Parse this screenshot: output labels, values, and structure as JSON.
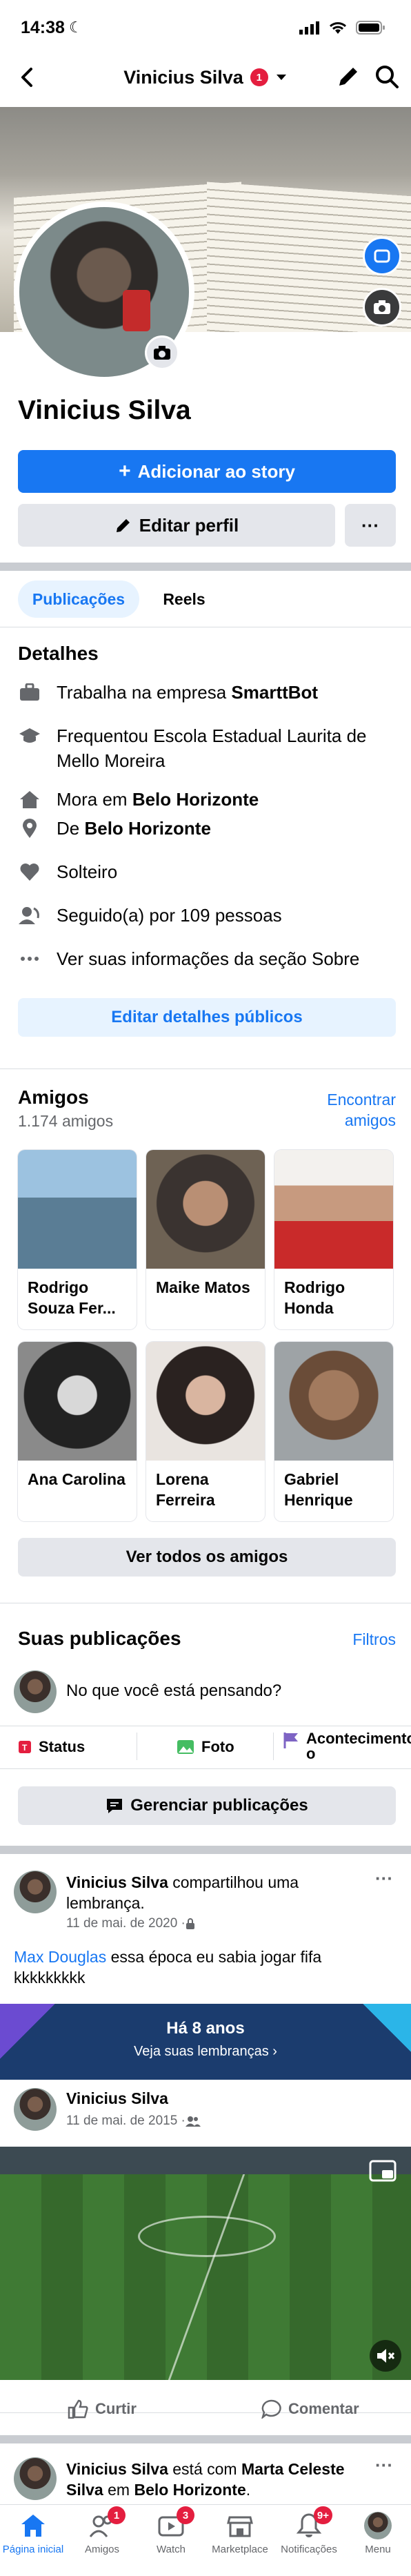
{
  "status_bar": {
    "time": "14:38"
  },
  "header": {
    "title": "Vinicius Silva",
    "badge": "1"
  },
  "profile": {
    "name": "Vinicius Silva",
    "add_story": "Adicionar ao story",
    "edit_profile": "Editar perfil",
    "more": "···"
  },
  "tabs": [
    {
      "label": "Publicações"
    },
    {
      "label": "Reels"
    }
  ],
  "details": {
    "heading": "Detalhes",
    "items": [
      {
        "prefix": "Trabalha na empresa ",
        "bold": "SmarttBot",
        "suffix": ""
      },
      {
        "prefix": "Frequentou Escola Estadual Laurita de Mello Moreira",
        "bold": "",
        "suffix": ""
      },
      {
        "prefix": "Mora em ",
        "bold": "Belo Horizonte",
        "suffix": ""
      },
      {
        "prefix": "De ",
        "bold": "Belo Horizonte",
        "suffix": ""
      },
      {
        "prefix": "Solteiro",
        "bold": "",
        "suffix": ""
      },
      {
        "prefix": "Seguido(a) por 109 pessoas",
        "bold": "",
        "suffix": ""
      },
      {
        "prefix": "Ver suas informações da seção Sobre",
        "bold": "",
        "suffix": ""
      }
    ],
    "edit_button": "Editar detalhes públicos"
  },
  "friends": {
    "heading": "Amigos",
    "count": "1.174 amigos",
    "find_line1": "Encontrar",
    "find_line2": "amigos",
    "list": [
      {
        "name": "Rodrigo Souza Fer..."
      },
      {
        "name": "Maike Matos"
      },
      {
        "name": "Rodrigo Honda"
      },
      {
        "name": "Ana Carolina"
      },
      {
        "name": "Lorena Ferreira"
      },
      {
        "name": "Gabriel Henrique"
      }
    ],
    "see_all": "Ver todos os amigos"
  },
  "publications": {
    "heading": "Suas publicações",
    "filters": "Filtros",
    "composer_placeholder": "No que você está pensando?",
    "actions": {
      "status": "Status",
      "photo": "Foto",
      "event_line1": "Acontecimento",
      "event_line2": "o"
    },
    "manage": "Gerenciar publicações"
  },
  "post1": {
    "author": "Vinicius Silva",
    "action_line1": " compartilhou uma",
    "action_line2": "lembrança.",
    "date": "11 de mai. de 2020 · ",
    "mention": "Max Douglas",
    "text_line1": " essa época eu sabia jogar fifa",
    "text_line2": "kkkkkkkkk",
    "memory_title": "Há 8 anos",
    "memory_link": "Veja suas lembranças ›",
    "inner_author": "Vinicius Silva",
    "inner_date": "11 de mai. de 2015 · ",
    "like": "Curtir",
    "comment": "Comentar"
  },
  "post2": {
    "author": "Vinicius Silva",
    "mid": " está com ",
    "tag": "Marta Celeste",
    "line2_prefix": "Silva",
    "line2_mid": " em ",
    "place": "Belo Horizonte",
    "line2_end": "."
  },
  "nav": [
    {
      "label": "Página inicial",
      "badge": ""
    },
    {
      "label": "Amigos",
      "badge": "1"
    },
    {
      "label": "Watch",
      "badge": "3"
    },
    {
      "label": "Marketplace",
      "badge": ""
    },
    {
      "label": "Notificações",
      "badge": "9+"
    },
    {
      "label": "Menu",
      "badge": ""
    }
  ],
  "colors": {
    "accent": "#1877f2",
    "badge": "#e41e3f",
    "separator": "#c9ccd1"
  }
}
